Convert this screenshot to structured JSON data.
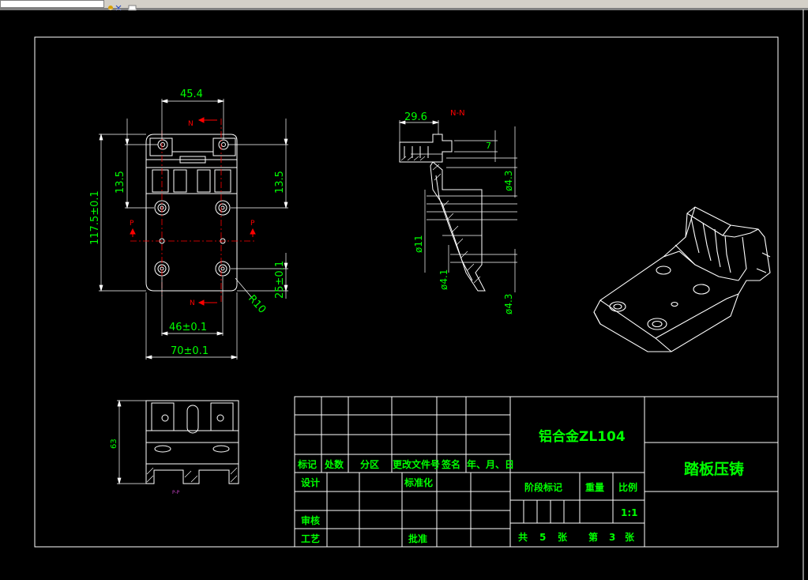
{
  "window": {
    "toolbar_icons": [
      "pan-icon",
      "zoom-icon"
    ]
  },
  "colors": {
    "background": "#000000",
    "line": "#ffffff",
    "dimension": "#00ff00",
    "title_text": "#00ff00",
    "section_mark": "#ff0000",
    "center_line": "#ff0000"
  },
  "front_view": {
    "dims": {
      "top_width": "45.4",
      "total_height": "117.5±0.1",
      "left_offset": "13.5",
      "right_offset": "13.5",
      "bottom_offset": "25±0.1",
      "hole_spacing": "46±0.1",
      "total_width": "70±0.1",
      "radius": "R10"
    },
    "section_marks": {
      "n_top": "N",
      "n_bottom": "N",
      "p_left": "P",
      "p_right": "P"
    }
  },
  "section_view": {
    "title": "N-N",
    "dims": {
      "top_width": "29.6",
      "height_7": "7",
      "dia_43_upper": "ø4.3",
      "dia_11": "ø11",
      "dia_41": "ø4.1",
      "dia_43_lower": "ø4.3"
    }
  },
  "bottom_view": {
    "height": "63",
    "label": "P-P"
  },
  "title_block": {
    "material": "铝合金ZL104",
    "part_name": "踏板压铸",
    "headers": [
      "标记",
      "处数",
      "分区",
      "更改文件号",
      "签名",
      "年、月、日"
    ],
    "rows": {
      "design": "设计",
      "standardize": "标准化",
      "review": "审核",
      "process": "工艺",
      "approve": "批准"
    },
    "stage_mark": "阶段标记",
    "weight": "重量",
    "scale_label": "比例",
    "scale_value": "1:1",
    "sheet_total_prefix": "共",
    "sheet_total": "5",
    "sheet_unit": "张",
    "sheet_no_prefix": "第",
    "sheet_no": "3",
    "sheet_no_unit": "张"
  }
}
